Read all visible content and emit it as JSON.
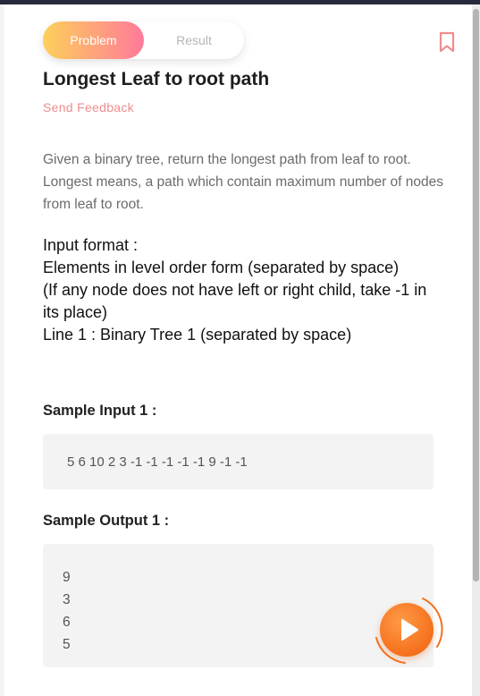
{
  "tabs": [
    {
      "label": "Problem",
      "active": true
    },
    {
      "label": "Result",
      "active": false
    }
  ],
  "problem": {
    "title": "Longest Leaf to root path",
    "feedback_label": "Send Feedback",
    "description": "Given a binary tree, return the longest path from leaf to root. Longest means, a path which contain maximum number of nodes from leaf to root.",
    "input_format_lines": [
      "Input format :",
      "Elements in level order form (separated by space)",
      "(If any node does not have left or right child, take -1 in its place)",
      "Line 1 : Binary Tree 1 (separated by space)"
    ]
  },
  "samples": {
    "input_label": "Sample Input 1 :",
    "input_value": "5 6 10 2 3 -1 -1 -1 -1 -1 9 -1 -1",
    "output_label": "Sample Output 1 :",
    "output_lines": [
      "9",
      "3",
      "6",
      "5"
    ]
  },
  "icons": {
    "bookmark": "bookmark-icon",
    "run": "play-icon"
  },
  "colors": {
    "accent_feedback": "#f08d8d",
    "tab_gradient_start": "#fdd05b",
    "tab_gradient_end": "#ff7a9a",
    "run_button": "#f5701c",
    "topbar": "#262a3b"
  }
}
